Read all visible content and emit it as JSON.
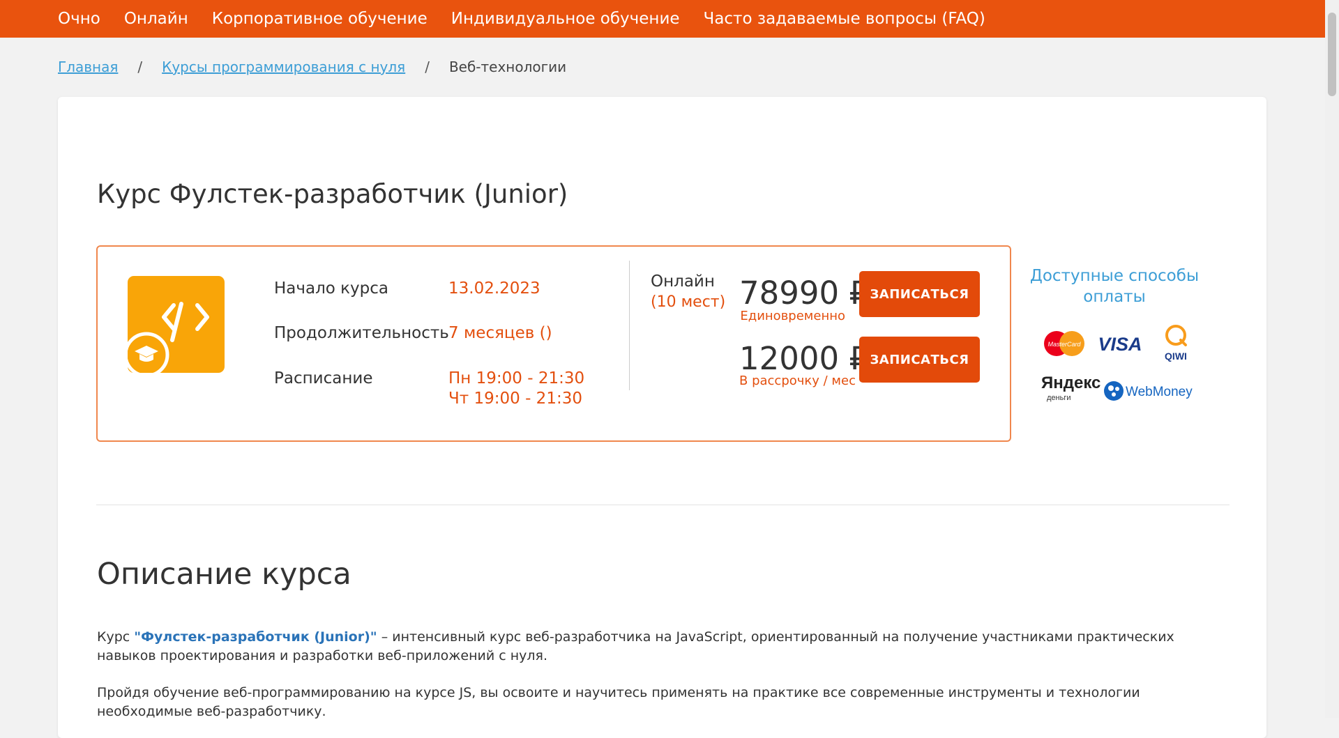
{
  "nav": {
    "items": [
      "Очно",
      "Онлайн",
      "Корпоративное обучение",
      "Индивидуальное обучение",
      "Часто задаваемые вопросы (FAQ)"
    ]
  },
  "breadcrumb": {
    "home": "Главная",
    "sep": "/",
    "parent": "Курсы программирования с нуля",
    "current": "Веб-технологии"
  },
  "course": {
    "title": "Курс Фулстек-разработчик (Junior)",
    "start_label": "Начало курса",
    "start_value": "13.02.2023",
    "duration_label": "Продолжительность",
    "duration_value": "7 месяцев ()",
    "schedule_label": "Расписание",
    "schedule_line1": "Пн 19:00 - 21:30",
    "schedule_line2": "Чт 19:00 - 21:30",
    "format": "Онлайн",
    "seats": "(10 мест)",
    "price_full": "78990",
    "price_full_note": "Единовременно",
    "price_installment": "12000",
    "price_installment_note": "В рассрочку / мес",
    "currency": "₽",
    "enroll_label": "ЗАПИСАТЬСЯ",
    "icon": "code-education-icon"
  },
  "payments": {
    "title": "Доступные способы оплаты",
    "methods": [
      "MasterCard",
      "VISA",
      "QIWI",
      "Яндекс",
      "деньги",
      "WebMoney"
    ]
  },
  "description": {
    "title": "Описание курса",
    "p1_prefix": "Курс ",
    "p1_highlight": "\"Фулстек-разработчик (Junior)\"",
    "p1_rest": " – интенсивный курс веб-разработчика на JavaScript, ориентированный на получение участниками практических навыков проектирования и разработки веб-приложений с нуля.",
    "p2": "Пройдя обучение веб-программированию на курсе JS, вы освоите и научитесь применять на практике все современные инструменты и технологии необходимые веб-разработчику."
  },
  "colors": {
    "accent": "#e9530e",
    "link": "#3d9ed6",
    "icon_bg": "#f9a508"
  }
}
